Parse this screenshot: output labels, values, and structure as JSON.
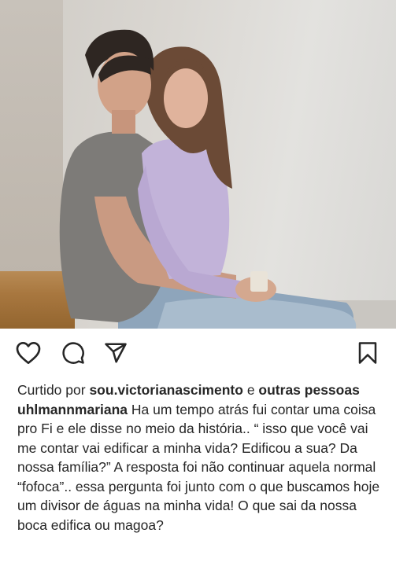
{
  "post": {
    "image_alt": "",
    "actions": {
      "like_icon": "heart-outline",
      "comment_icon": "speech-bubble",
      "share_icon": "paper-plane",
      "save_icon": "bookmark"
    },
    "likes": {
      "prefix": "Curtido por",
      "user": "sou.victorianascimento",
      "conjunction": "e",
      "others": "outras pessoas"
    },
    "caption": {
      "username": "uhlmannmariana",
      "text": "Ha um tempo atrás fui contar uma coisa pro Fi e ele disse no meio da história.. “ isso que você vai me contar vai edificar a minha vida? Edificou a sua? Da nossa família?” A resposta foi não continuar aquela normal “fofoca”.. essa pergunta foi junto com o que buscamos hoje um divisor de águas na minha vida! O que sai da nossa boca edifica ou magoa?"
    }
  }
}
